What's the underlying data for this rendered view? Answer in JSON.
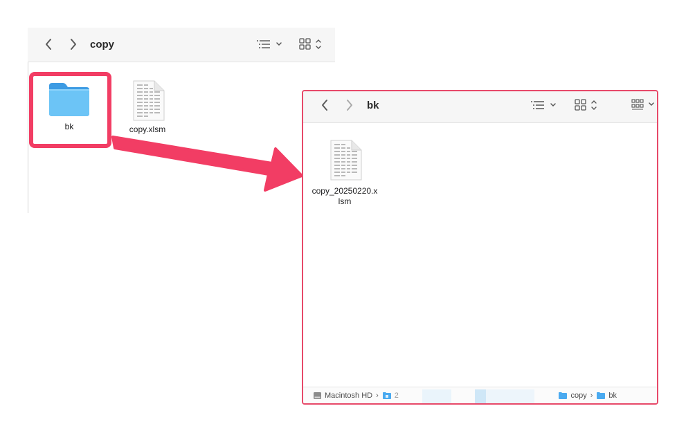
{
  "left_window": {
    "title": "copy",
    "items": [
      {
        "label": "bk",
        "icon": "folder-icon"
      },
      {
        "label": "copy.xlsm",
        "icon": "spreadsheet-document-icon"
      }
    ]
  },
  "right_window": {
    "title": "bk",
    "items": [
      {
        "label_line1": "copy_20250220.x",
        "label_line2": "lsm",
        "icon": "spreadsheet-document-icon"
      }
    ],
    "pathbar": {
      "disk": "Macintosh HD",
      "truncated": "2",
      "copy": "copy",
      "bk": "bk"
    }
  },
  "colors": {
    "highlight": "#f23d64",
    "arrow": "#f23d64",
    "folder": "#5ab8f0",
    "toolbar_bg": "#f6f6f6"
  }
}
